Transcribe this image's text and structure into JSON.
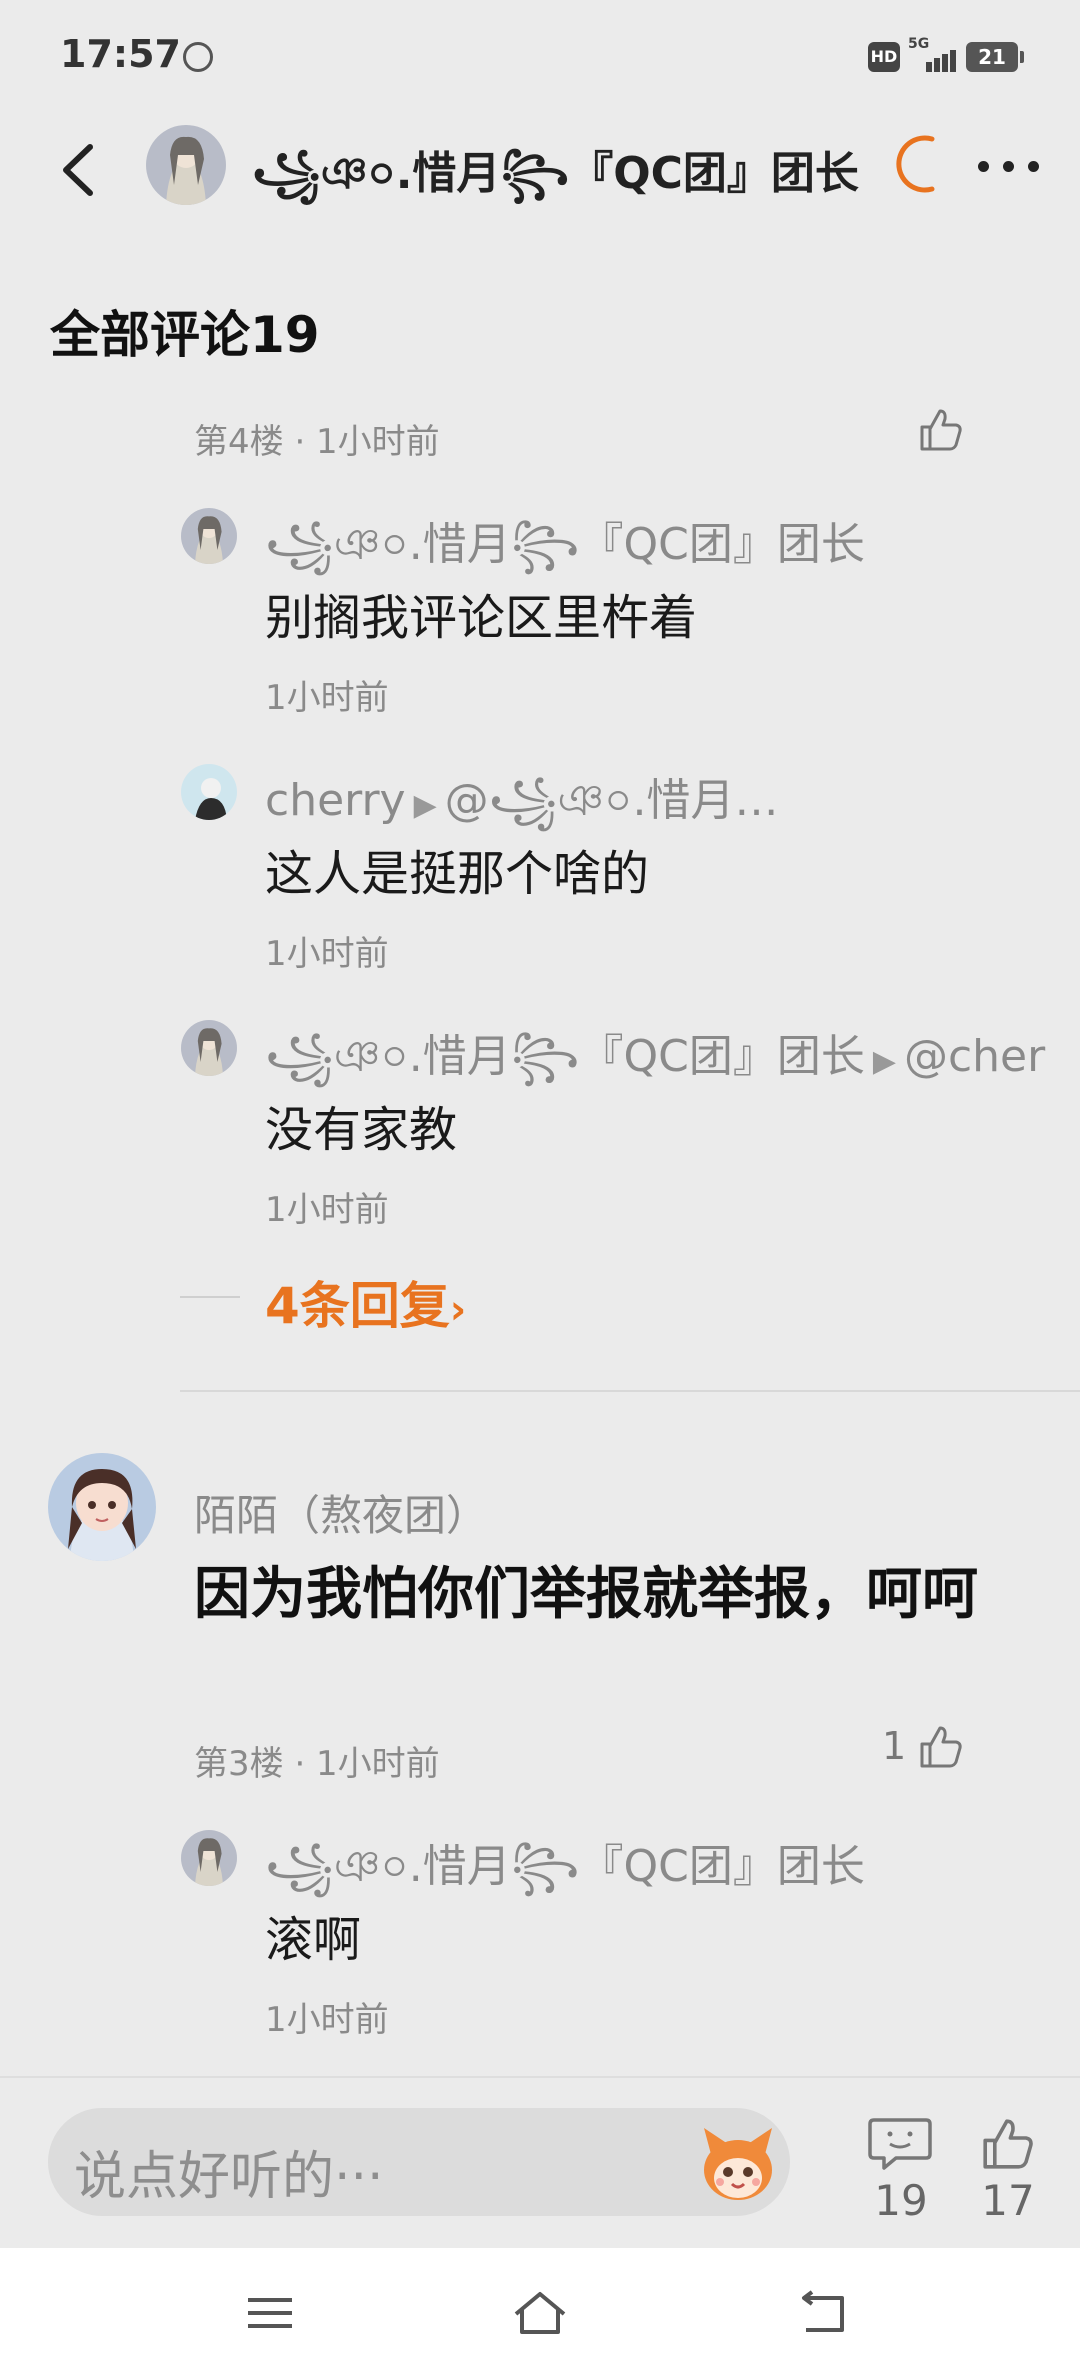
{
  "status": {
    "time": "17:57",
    "hd": "HD",
    "network": "5G",
    "battery": "21"
  },
  "header": {
    "title": "꧁ঞ০.惜月꧂『QC团』团长"
  },
  "section": {
    "title": "全部评论19"
  },
  "floor4": {
    "meta": "第4楼 · 1小时前"
  },
  "replies": [
    {
      "name": "꧁ঞ০.惜月꧂『QC团』团长",
      "target": "",
      "text": "别搁我评论区里杵着",
      "time": "1小时前"
    },
    {
      "name": "cherry",
      "target": "@꧁ঞ০.惜月…",
      "text": "这人是挺那个啥的",
      "time": "1小时前"
    },
    {
      "name": "꧁ঞ০.惜月꧂『QC团』团长",
      "target": "@cher",
      "text": "没有家教",
      "time": "1小时前"
    }
  ],
  "more_replies": {
    "label": "4条回复"
  },
  "comment3": {
    "name": "陌陌（熬夜团）",
    "text": "因为我怕你们举报就举报，呵呵",
    "meta": "第3楼 · 1小时前",
    "likes": "1"
  },
  "reply4": {
    "name": "꧁ঞ০.惜月꧂『QC团』团长",
    "text": "滚啊",
    "time": "1小时前"
  },
  "bottom": {
    "placeholder": "说点好听的···",
    "comment_count": "19",
    "like_count": "17"
  },
  "colors": {
    "accent": "#e8731f",
    "background": "#ebebeb"
  },
  "icons": [
    "back-arrow-icon",
    "more-icon",
    "loading-spinner-icon",
    "thumbs-up-icon",
    "comment-icon",
    "mascot-icon",
    "menu-icon",
    "home-icon",
    "back-nav-icon"
  ]
}
